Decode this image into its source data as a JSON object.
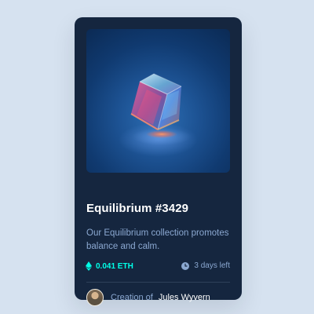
{
  "card": {
    "title": "Equilibrium #3429",
    "description": "Our Equilibrium collection promotes balance and calm.",
    "price": "0.041 ETH",
    "time_left": "3 days left",
    "creator_prefix": "Creation of",
    "creator_name": "Jules Wyvern"
  },
  "icons": {
    "price": "ethereum-icon",
    "time": "clock-icon",
    "avatar": "avatar"
  },
  "colors": {
    "page_background": "#d6e2f0",
    "card_background": "#15263f",
    "accent": "#00ffe7",
    "muted_text": "#8ba8d1",
    "title_text": "#ffffff",
    "divider": "#2e405a"
  }
}
